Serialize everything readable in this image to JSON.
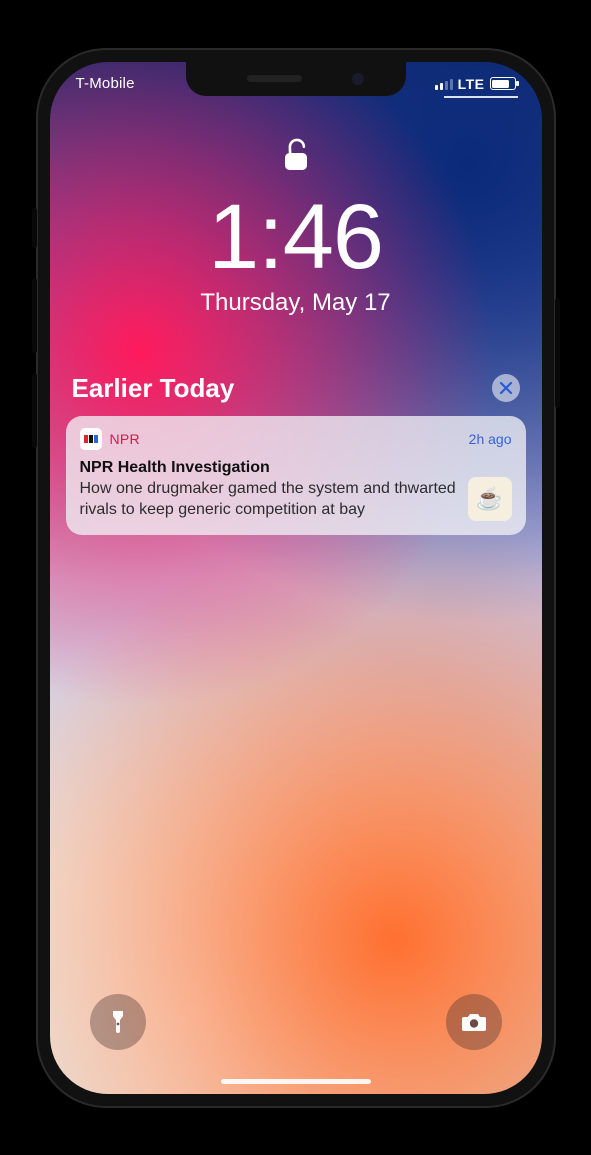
{
  "status": {
    "carrier": "T-Mobile",
    "network": "LTE",
    "battery_percent": 70,
    "signal_bars_active": 2,
    "signal_bars_total": 4
  },
  "lock": {
    "state": "unlocked",
    "time": "1:46",
    "date": "Thursday, May 17"
  },
  "section": {
    "title": "Earlier Today"
  },
  "notification": {
    "app_name": "NPR",
    "time_ago": "2h ago",
    "title": "NPR Health Investigation",
    "body": "How one drugmaker gamed the system and thwarted rivals to keep generic competition at bay",
    "thumb_icon": "coffee-cup-icon",
    "accent_color": "#d6184d"
  },
  "bottom": {
    "left_icon": "flashlight-icon",
    "right_icon": "camera-icon"
  }
}
